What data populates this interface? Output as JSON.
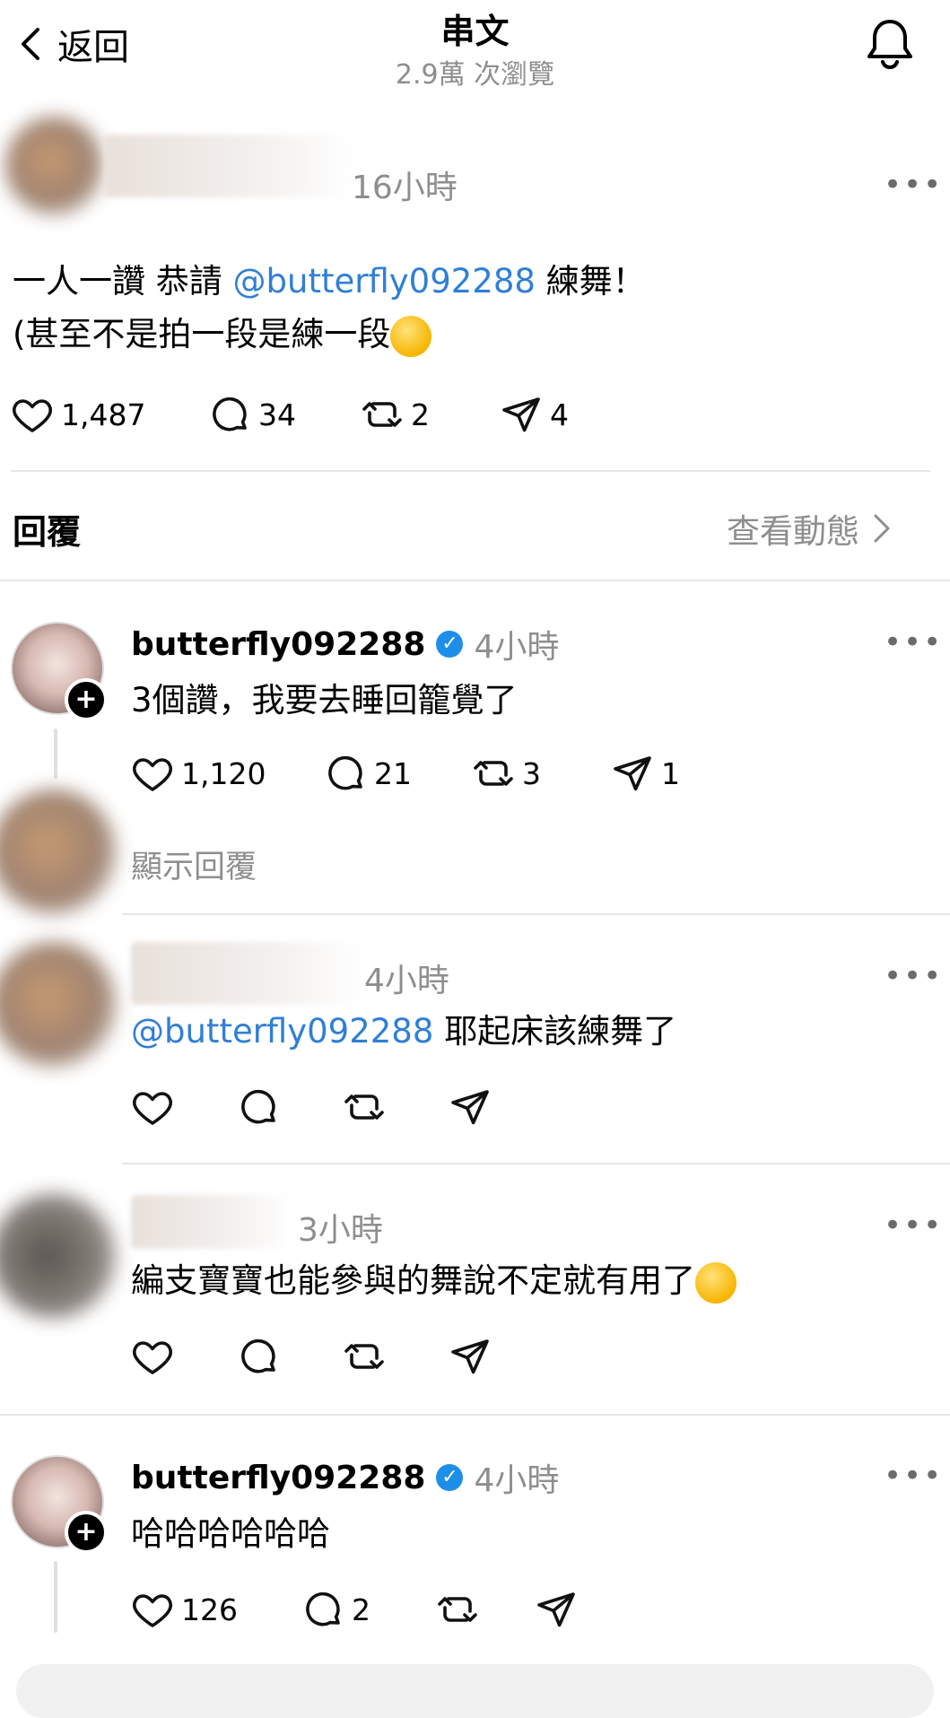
{
  "header": {
    "back_label": "返回",
    "title": "串文",
    "subtitle": "2.9萬 次瀏覽"
  },
  "main_post": {
    "time": "16小時",
    "text_line1_pre": "一人一讚 恭請 ",
    "mention": "@butterfly092288",
    "text_line1_post": " 練舞！",
    "text_line2": "(甚至不是拍一段是練一段",
    "likes": "1,487",
    "comments": "34",
    "reposts": "2",
    "shares": "4"
  },
  "replies_header": {
    "label": "回覆",
    "activity_link": "查看動態"
  },
  "replies": [
    {
      "username": "butterfly092288",
      "time": "4小時",
      "text": "3個讚，我要去睡回籠覺了",
      "likes": "1,120",
      "comments": "21",
      "reposts": "3",
      "shares": "1",
      "show_replies": "顯示回覆"
    },
    {
      "time": "4小時",
      "mention": "@butterfly092288",
      "text": " 耶起床該練舞了"
    },
    {
      "time": "3小時",
      "text": "編支寶寶也能參與的舞說不定就有用了"
    },
    {
      "username": "butterfly092288",
      "time": "4小時",
      "text": "哈哈哈哈哈哈",
      "likes": "126",
      "comments": "2"
    }
  ],
  "icons": {
    "back": "chevron-left-icon",
    "bell": "bell-icon",
    "like": "heart-icon",
    "comment": "comment-icon",
    "repost": "repost-icon",
    "share": "send-icon",
    "more": "more-icon",
    "verified": "verified-icon"
  },
  "colors": {
    "mention": "#2f7fd6",
    "secondary_text": "#8e8e8e",
    "verified": "#1d8fe8"
  }
}
